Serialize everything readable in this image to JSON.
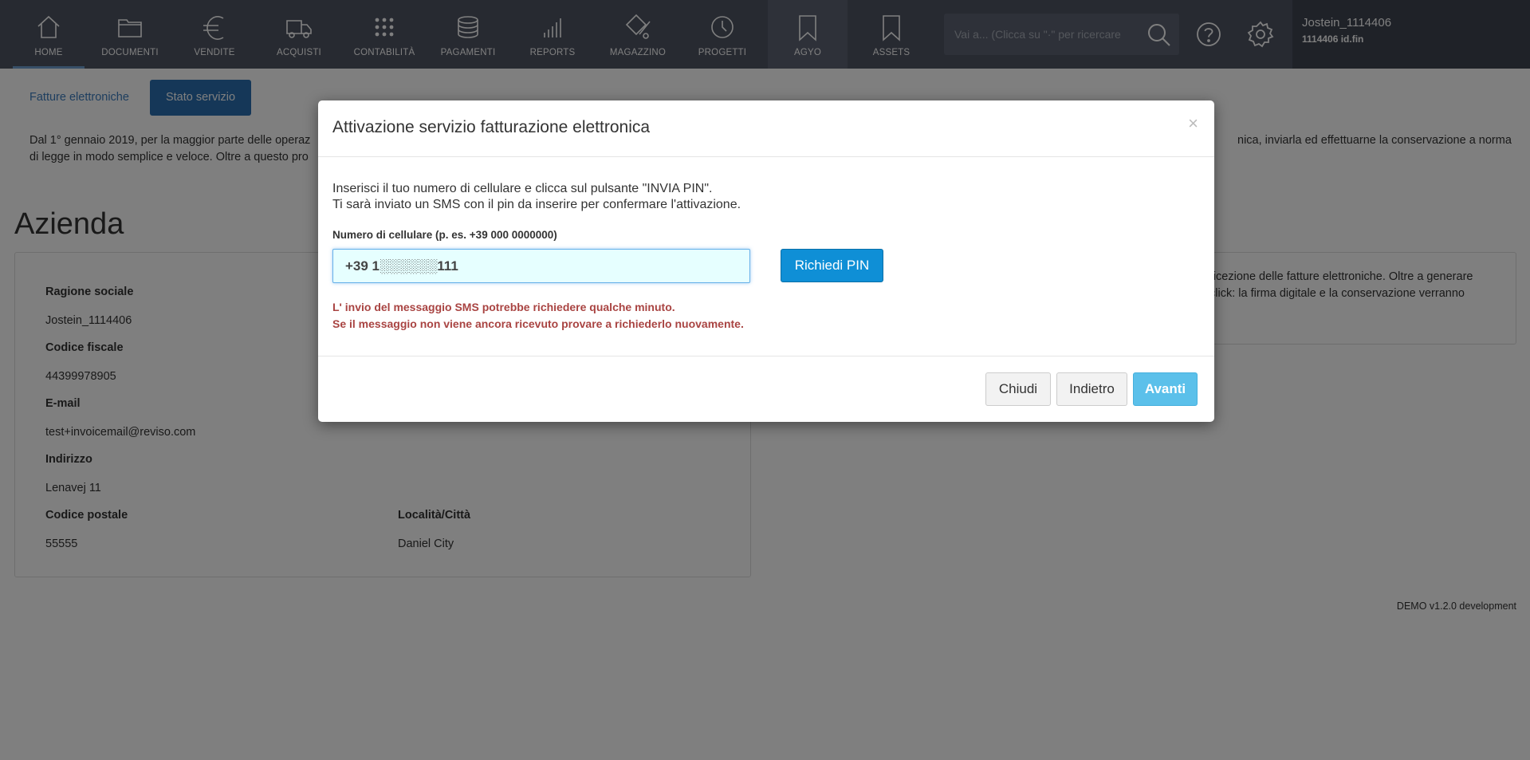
{
  "nav": {
    "items": [
      {
        "label": "HOME",
        "icon": "home-icon"
      },
      {
        "label": "DOCUMENTI",
        "icon": "folder-icon"
      },
      {
        "label": "VENDITE",
        "icon": "euro-icon"
      },
      {
        "label": "ACQUISTI",
        "icon": "truck-icon"
      },
      {
        "label": "CONTABILITÀ",
        "icon": "grid-dots-icon"
      },
      {
        "label": "PAGAMENTI",
        "icon": "coins-stack-icon"
      },
      {
        "label": "REPORTS",
        "icon": "signal-bars-icon"
      },
      {
        "label": "MAGAZZINO",
        "icon": "warehouse-icon"
      },
      {
        "label": "PROGETTI",
        "icon": "clock-icon"
      },
      {
        "label": "AGYO",
        "icon": "bookmark-icon"
      },
      {
        "label": "ASSETS",
        "icon": "bookmark-icon"
      }
    ],
    "search_placeholder": "Vai a... (Clicca su \"·\" per ricercare",
    "user_name": "Jostein_1114406",
    "user_id": "1114406 id.fin"
  },
  "tabs": {
    "link": "Fatture elettroniche",
    "active": "Stato servizio"
  },
  "intro": {
    "line1_start": "Dal 1° gennaio 2019, per la maggior parte delle operaz",
    "line1_end": "nica, inviarla ed effettuarne la conservazione a norma",
    "line2_start": "di legge in modo semplice e veloce. Oltre a questo pro"
  },
  "azienda": {
    "heading": "Azienda",
    "ragione_label": "Ragione sociale",
    "ragione_value": "Jostein_1114406",
    "cf_label": "Codice fiscale",
    "cf_value": "44399978905",
    "email_label": "E-mail",
    "email_value": "test+invoicemail@reviso.com",
    "indirizzo_label": "Indirizzo",
    "indirizzo_value": "Lenavej 11",
    "cap_label": "Codice postale",
    "cap_value": "55555",
    "citta_label": "Località/Città",
    "citta_value": "Daniel City"
  },
  "right_panel": {
    "line1": "ricezione delle fatture elettroniche. Oltre a generare",
    "line2": "click: la firma digitale e la conservazione verranno"
  },
  "footer": {
    "version": "DEMO v1.2.0 development"
  },
  "modal": {
    "title": "Attivazione servizio fatturazione elettronica",
    "close": "×",
    "instr1": "Inserisci il tuo numero di cellulare e clicca sul pulsante \"INVIA PIN\".",
    "instr2": "Ti sarà inviato un SMS con il pin da inserire per confermare l'attivazione.",
    "phone_label": "Numero di cellulare (p. es. +39 000 0000000)",
    "phone_value": "+39 1░░░░░░111",
    "pin_button": "Richiedi PIN",
    "warning1": "L' invio del messaggio SMS potrebbe richiedere qualche minuto.",
    "warning2": "Se il messaggio non viene ancora ricevuto provare a richiederlo nuovamente.",
    "btn_close": "Chiudi",
    "btn_back": "Indietro",
    "btn_next": "Avanti"
  }
}
